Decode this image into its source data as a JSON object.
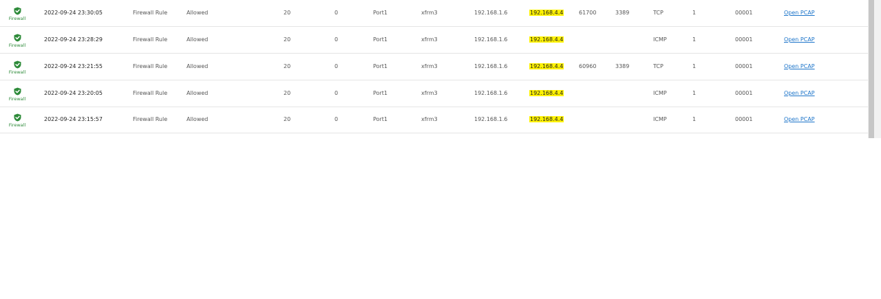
{
  "rows": [
    {
      "module": "Firewall",
      "time": "2022-09-24 23:30:05",
      "log_type": "Firewall Rule",
      "status": "Allowed",
      "policy": "20",
      "user_group": "0",
      "in_interface": "Port1",
      "out_interface": "xfrm3",
      "src_ip": "192.168.1.6",
      "dst_ip": "192.168.4.4",
      "src_port": "61700",
      "dst_port": "3389",
      "protocol": "TCP",
      "rule_count": "1",
      "rule_id": "00001",
      "pcap": "Open PCAP"
    },
    {
      "module": "Firewall",
      "time": "2022-09-24 23:28:29",
      "log_type": "Firewall Rule",
      "status": "Allowed",
      "policy": "20",
      "user_group": "0",
      "in_interface": "Port1",
      "out_interface": "xfrm3",
      "src_ip": "192.168.1.6",
      "dst_ip": "192.168.4.4",
      "src_port": "",
      "dst_port": "",
      "protocol": "ICMP",
      "rule_count": "1",
      "rule_id": "00001",
      "pcap": "Open PCAP"
    },
    {
      "module": "Firewall",
      "time": "2022-09-24 23:21:55",
      "log_type": "Firewall Rule",
      "status": "Allowed",
      "policy": "20",
      "user_group": "0",
      "in_interface": "Port1",
      "out_interface": "xfrm3",
      "src_ip": "192.168.1.6",
      "dst_ip": "192.168.4.4",
      "src_port": "60960",
      "dst_port": "3389",
      "protocol": "TCP",
      "rule_count": "1",
      "rule_id": "00001",
      "pcap": "Open PCAP"
    },
    {
      "module": "Firewall",
      "time": "2022-09-24 23:20:05",
      "log_type": "Firewall Rule",
      "status": "Allowed",
      "policy": "20",
      "user_group": "0",
      "in_interface": "Port1",
      "out_interface": "xfrm3",
      "src_ip": "192.168.1.6",
      "dst_ip": "192.168.4.4",
      "src_port": "",
      "dst_port": "",
      "protocol": "ICMP",
      "rule_count": "1",
      "rule_id": "00001",
      "pcap": "Open PCAP"
    },
    {
      "module": "Firewall",
      "time": "2022-09-24 23:15:57",
      "log_type": "Firewall Rule",
      "status": "Allowed",
      "policy": "20",
      "user_group": "0",
      "in_interface": "Port1",
      "out_interface": "xfrm3",
      "src_ip": "192.168.1.6",
      "dst_ip": "192.168.4.4",
      "src_port": "",
      "dst_port": "",
      "protocol": "ICMP",
      "rule_count": "1",
      "rule_id": "00001",
      "pcap": "Open PCAP"
    }
  ],
  "icons": {
    "module": "shield-check-icon"
  },
  "colors": {
    "shield": "#2e8b3a",
    "highlight": "#fff200",
    "link": "#1a73c9"
  }
}
